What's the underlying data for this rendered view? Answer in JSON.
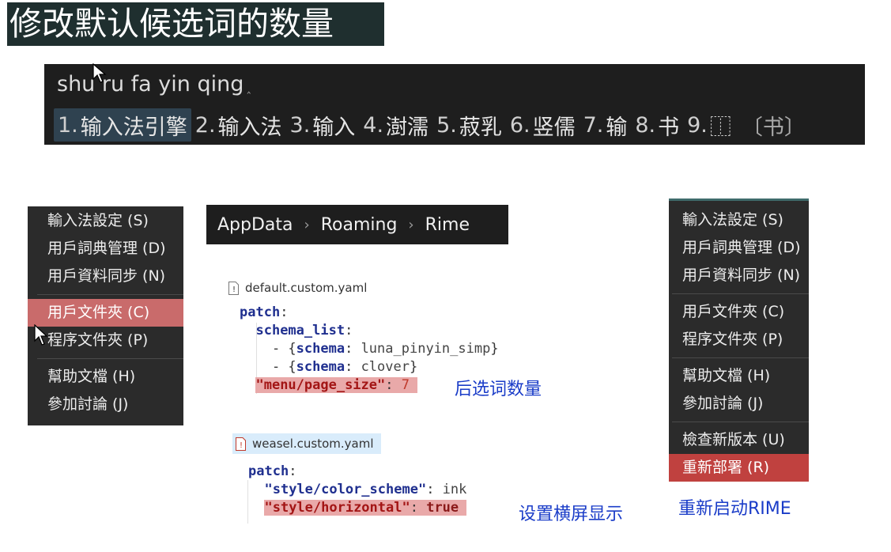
{
  "title": "修改默认候选词的数量",
  "candidate_bar": {
    "preedit": "shu ru fa yin qing",
    "preedit_caret": "‸",
    "candidates": [
      {
        "num": "1.",
        "text": "输入法引擎",
        "highlighted": true
      },
      {
        "num": "2.",
        "text": "输入法",
        "highlighted": false
      },
      {
        "num": "3.",
        "text": "输入",
        "highlighted": false
      },
      {
        "num": "4.",
        "text": "澍濡",
        "highlighted": false
      },
      {
        "num": "5.",
        "text": "菽乳",
        "highlighted": false
      },
      {
        "num": "6.",
        "text": "竖儒",
        "highlighted": false
      },
      {
        "num": "7.",
        "text": "输",
        "highlighted": false
      },
      {
        "num": "8.",
        "text": "书",
        "highlighted": false
      },
      {
        "num": "9.",
        "text": "⿰",
        "highlighted": false
      }
    ],
    "comment": "〔书〕"
  },
  "menu_left": {
    "items": [
      {
        "label": "輸入法設定 (S)"
      },
      {
        "label": "用戶詞典管理 (D)"
      },
      {
        "label": "用戶資料同步 (N)"
      },
      {
        "label": "用戶文件夾 (C)",
        "highlighted": true
      },
      {
        "label": "程序文件夾 (P)"
      },
      {
        "label": "幫助文檔 (H)"
      },
      {
        "label": "參加討論 (J)"
      }
    ]
  },
  "breadcrumb": {
    "parts": [
      "AppData",
      "Roaming",
      "Rime"
    ],
    "separator": "›"
  },
  "file1": {
    "name": "default.custom.yaml",
    "lines": {
      "l1_key": "patch",
      "l2_key": "schema_list",
      "l3_key": "schema",
      "l3_val": "luna_pinyin_simp",
      "l4_key": "schema",
      "l4_val": "clover",
      "l5_key": "\"menu/page_size\"",
      "l5_val": "7"
    }
  },
  "annotation1": "后选词数量",
  "file2": {
    "name": "weasel.custom.yaml",
    "lines": {
      "l1_key": "patch",
      "l2_key": "\"style/color_scheme\"",
      "l2_val": "ink",
      "l3_key": "\"style/horizontal\"",
      "l3_val": "true"
    }
  },
  "annotation2": "设置横屏显示",
  "menu_right": {
    "items": [
      {
        "label": "輸入法設定 (S)"
      },
      {
        "label": "用戶詞典管理 (D)"
      },
      {
        "label": "用戶資料同步 (N)"
      },
      {
        "label": "用戶文件夾 (C)"
      },
      {
        "label": "程序文件夾 (P)"
      },
      {
        "label": "幫助文檔 (H)"
      },
      {
        "label": "參加討論 (J)"
      },
      {
        "label": "檢查新版本 (U)"
      },
      {
        "label": "重新部署 (R)",
        "highlighted": true
      }
    ]
  },
  "annotation3": "重新启动RIME",
  "colors": {
    "title_bg": "#1f2f2f",
    "annotation": "#1a3cc8",
    "menu_highlight": "#c96b6b",
    "code_highlight": "#e9a9a9",
    "file2_tab": "#d9ecfb"
  },
  "icons": [
    "mouse-cursor-icon",
    "file-warning-icon"
  ]
}
